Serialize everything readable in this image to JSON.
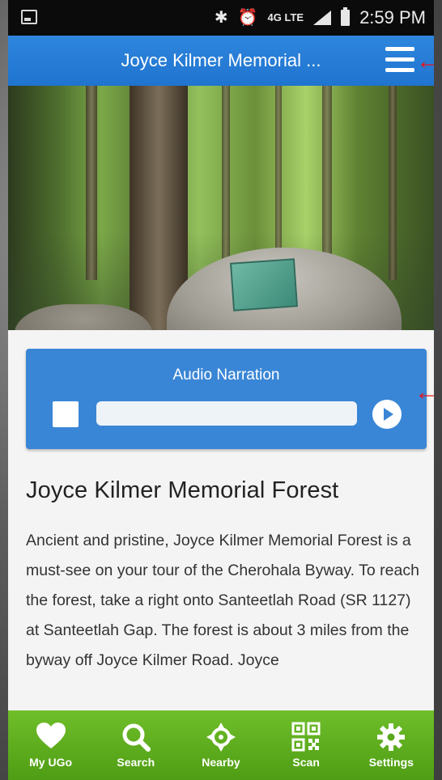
{
  "status_bar": {
    "time": "2:59 PM",
    "network_label": "4G LTE",
    "icons": [
      "screenshot-icon",
      "bluetooth-icon",
      "alarm-icon",
      "lte-icon",
      "signal-icon",
      "battery-icon"
    ]
  },
  "header": {
    "title": "Joyce Kilmer Memorial ...",
    "menu_icon": "hamburger-menu-icon"
  },
  "hero": {
    "description_icon": "forest-photo"
  },
  "audio": {
    "title": "Audio Narration",
    "progress": 0,
    "stop_icon": "stop-icon",
    "play_icon": "play-icon"
  },
  "content": {
    "heading": "Joyce Kilmer Memorial Forest",
    "body": "Ancient and pristine, Joyce Kilmer Memorial Forest is a must-see on your tour of the Cherohala Byway. To reach the forest, take a right onto Santeetlah Road (SR 1127) at Santeetlah Gap. The forest is about 3 miles from the byway off Joyce Kilmer Road.  Joyce"
  },
  "bottom_nav": {
    "items": [
      {
        "label": "My UGo",
        "icon": "heart-icon"
      },
      {
        "label": "Search",
        "icon": "search-icon"
      },
      {
        "label": "Nearby",
        "icon": "crosshair-icon"
      },
      {
        "label": "Scan",
        "icon": "qr-code-icon"
      },
      {
        "label": "Settings",
        "icon": "gear-icon"
      }
    ]
  },
  "colors": {
    "header_blue": "#2f86dd",
    "audio_card_blue": "#3a86d6",
    "nav_green": "#5fae1f",
    "annotation_red": "#e8131b"
  }
}
